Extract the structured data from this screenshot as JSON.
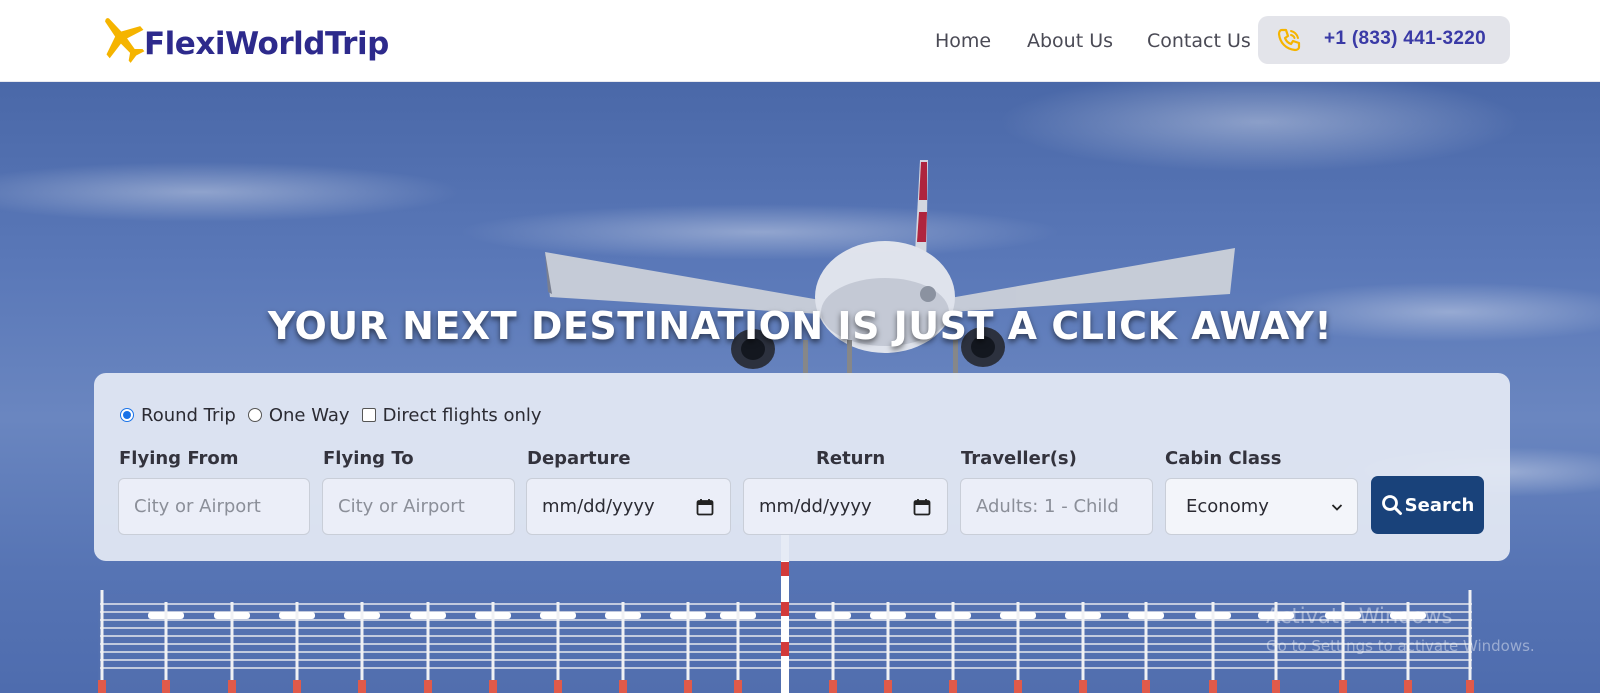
{
  "brand": {
    "name": "FlexiWorldTrip"
  },
  "nav": {
    "home": "Home",
    "about": "About Us",
    "contact": "Contact Us",
    "phone": "+1 (833) 441-3220"
  },
  "hero": {
    "title": "YOUR NEXT DESTINATION IS JUST A CLICK AWAY!"
  },
  "search": {
    "trip_options": {
      "round_trip": "Round Trip",
      "one_way": "One Way",
      "direct": "Direct flights only",
      "selected": "round_trip"
    },
    "labels": {
      "from": "Flying From",
      "to": "Flying To",
      "departure": "Departure",
      "return": "Return",
      "travellers": "Traveller(s)",
      "cabin": "Cabin Class"
    },
    "placeholders": {
      "from": "City or Airport",
      "to": "City or Airport",
      "departure": "mm/dd/yyyy",
      "return": "mm/dd/yyyy",
      "travellers": "Adults: 1 - Child"
    },
    "cabin_value": "Economy",
    "button": "Search"
  },
  "os_watermark": {
    "line1": "Activate Windows",
    "line2": "Go to Settings to activate Windows."
  },
  "colors": {
    "brand_navy": "#2d2a8c",
    "plane_yellow": "#f5b400",
    "button_navy": "#19427a",
    "phone_text": "#3a3aa6"
  }
}
